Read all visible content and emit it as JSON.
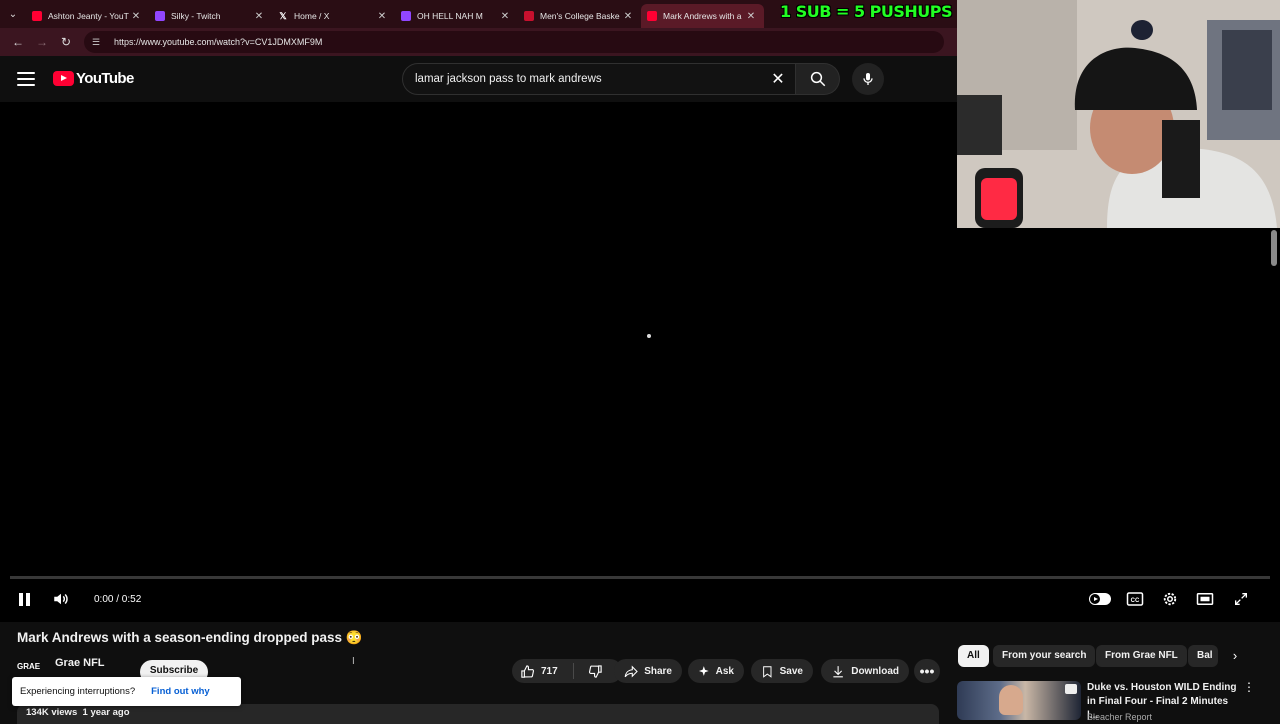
{
  "browser": {
    "tabs": [
      {
        "title": "Ashton Jeanty - YouT",
        "favicon": "youtube-icon",
        "active": false
      },
      {
        "title": "Silky - Twitch",
        "favicon": "twitch-icon",
        "active": false
      },
      {
        "title": "Home / X",
        "favicon": "x-icon",
        "active": false
      },
      {
        "title": "OH HELL NAH M",
        "favicon": "twitch-icon",
        "active": false
      },
      {
        "title": "Men's College Baske",
        "favicon": "ncaa-icon",
        "active": false
      },
      {
        "title": "Mark Andrews with a",
        "favicon": "youtube-icon",
        "active": true
      }
    ],
    "url": "https://www.youtube.com/watch?v=CV1JDMXMF9M"
  },
  "youtube": {
    "logo_text": "YouTube",
    "search_query": "lamar jackson pass to mark andrews",
    "player": {
      "time": "0:00 / 0:52",
      "progress": 0,
      "autoplay_on": true
    },
    "video": {
      "title": "Mark Andrews with a season-ending dropped pass 😳",
      "channel_avatar_text": "GRAE",
      "channel_name": "Grae NFL",
      "subscribe_label": "Subscribe",
      "likes": "717",
      "share_label": "Share",
      "ask_label": "Ask",
      "save_label": "Save",
      "download_label": "Download",
      "views": "134K views",
      "age": "1 year ago"
    },
    "toast": {
      "message": "Experiencing interruptions?",
      "link": "Find out why"
    },
    "chips": [
      "All",
      "From your search",
      "From Grae NFL",
      "Bal"
    ],
    "recommendation": {
      "title": "Duke vs. Houston WILD Ending in Final Four - Final 2 Minutes |...",
      "channel": "Bleacher Report"
    }
  },
  "stream_overlay": {
    "text": "1 SUB = 5 PUSHUPS",
    "color": "#22ff22"
  },
  "colors": {
    "browser_frame": "#2a0d14",
    "youtube_red": "#ff0033",
    "link_blue": "#065fd4"
  }
}
